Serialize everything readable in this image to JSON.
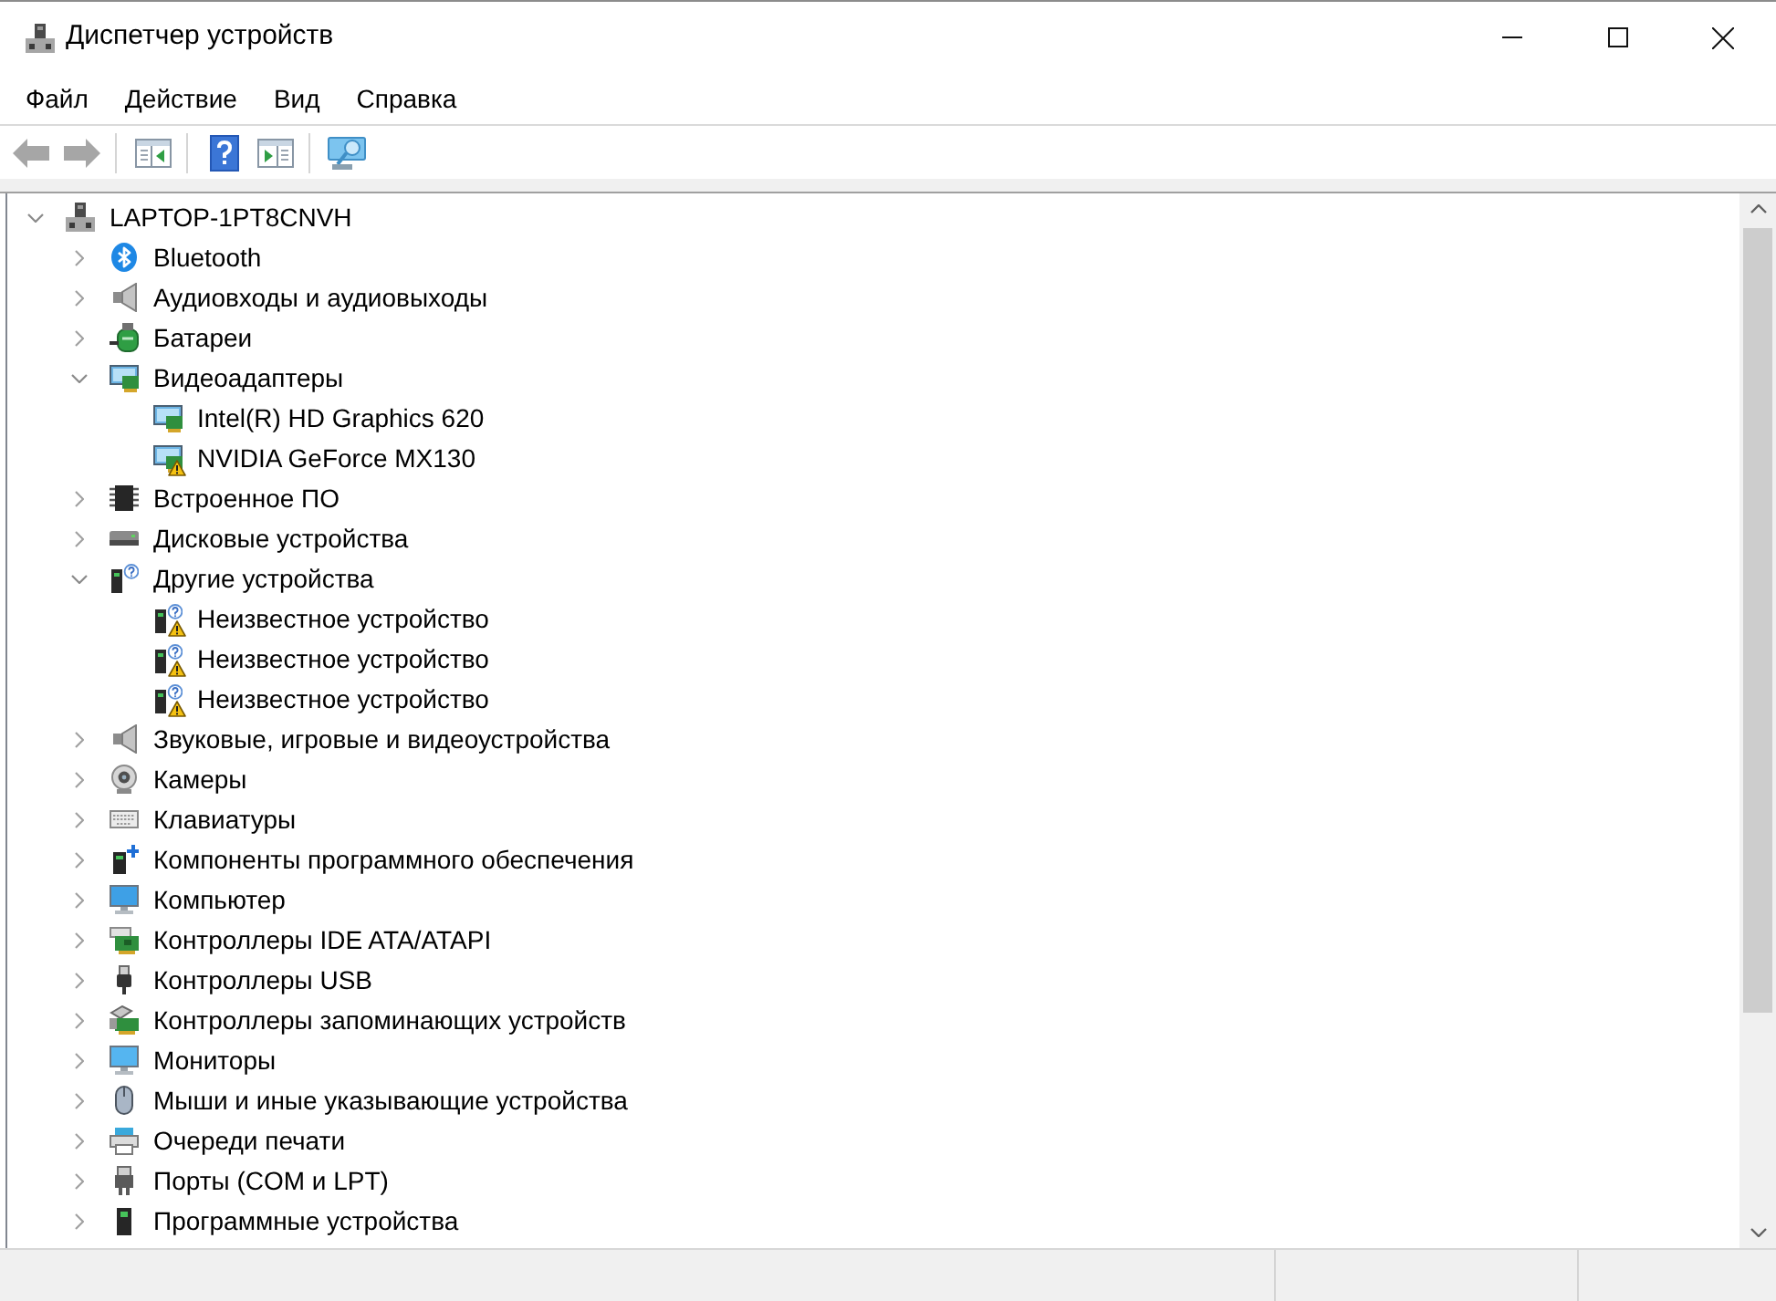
{
  "window": {
    "title": "Диспетчер устройств"
  },
  "menu": [
    "Файл",
    "Действие",
    "Вид",
    "Справка"
  ],
  "toolbar": {
    "groups": [
      {
        "buttons": [
          {
            "kind": "back",
            "disabled": true
          },
          {
            "kind": "forward",
            "disabled": true
          }
        ]
      },
      {
        "buttons": [
          {
            "kind": "console_tree",
            "disabled": false
          }
        ]
      },
      {
        "buttons": [
          {
            "kind": "help",
            "disabled": false
          },
          {
            "kind": "action_pane",
            "disabled": false
          }
        ]
      },
      {
        "buttons": [
          {
            "kind": "scan",
            "disabled": false
          }
        ]
      }
    ]
  },
  "tree": {
    "label": "LAPTOP-1PT8CNVH",
    "kind": "computer",
    "expanded": true,
    "children": [
      {
        "label": "Bluetooth",
        "kind": "bluetooth",
        "expanded": false
      },
      {
        "label": "Аудиовходы и аудиовыходы",
        "kind": "audio",
        "expanded": false
      },
      {
        "label": "Батареи",
        "kind": "battery",
        "expanded": false
      },
      {
        "label": "Видеоадаптеры",
        "kind": "display",
        "expanded": true,
        "children": [
          {
            "label": "Intel(R) HD Graphics 620",
            "kind": "display",
            "warning": false
          },
          {
            "label": "NVIDIA GeForce MX130",
            "kind": "display",
            "warning": true
          }
        ]
      },
      {
        "label": "Встроенное ПО",
        "kind": "firmware",
        "expanded": false
      },
      {
        "label": "Дисковые устройства",
        "kind": "disk",
        "expanded": false
      },
      {
        "label": "Другие устройства",
        "kind": "other",
        "expanded": true,
        "children": [
          {
            "label": "Неизвестное устройство",
            "kind": "other",
            "warning": true
          },
          {
            "label": "Неизвестное устройство",
            "kind": "other",
            "warning": true
          },
          {
            "label": "Неизвестное устройство",
            "kind": "other",
            "warning": true
          }
        ]
      },
      {
        "label": "Звуковые, игровые и видеоустройства",
        "kind": "audio",
        "expanded": false
      },
      {
        "label": "Камеры",
        "kind": "camera",
        "expanded": false
      },
      {
        "label": "Клавиатуры",
        "kind": "keyboard",
        "expanded": false
      },
      {
        "label": "Компоненты программного обеспечения",
        "kind": "component",
        "expanded": false
      },
      {
        "label": "Компьютер",
        "kind": "pc",
        "expanded": false
      },
      {
        "label": "Контроллеры IDE ATA/ATAPI",
        "kind": "ide",
        "expanded": false
      },
      {
        "label": "Контроллеры USB",
        "kind": "usb",
        "expanded": false
      },
      {
        "label": "Контроллеры запоминающих устройств",
        "kind": "storage",
        "expanded": false
      },
      {
        "label": "Мониторы",
        "kind": "monitor",
        "expanded": false
      },
      {
        "label": "Мыши и иные указывающие устройства",
        "kind": "mouse",
        "expanded": false
      },
      {
        "label": "Очереди печати",
        "kind": "printer",
        "expanded": false
      },
      {
        "label": "Порты (COM и LPT)",
        "kind": "port",
        "expanded": false
      },
      {
        "label": "Программные устройства",
        "kind": "software",
        "expanded": false
      }
    ]
  }
}
